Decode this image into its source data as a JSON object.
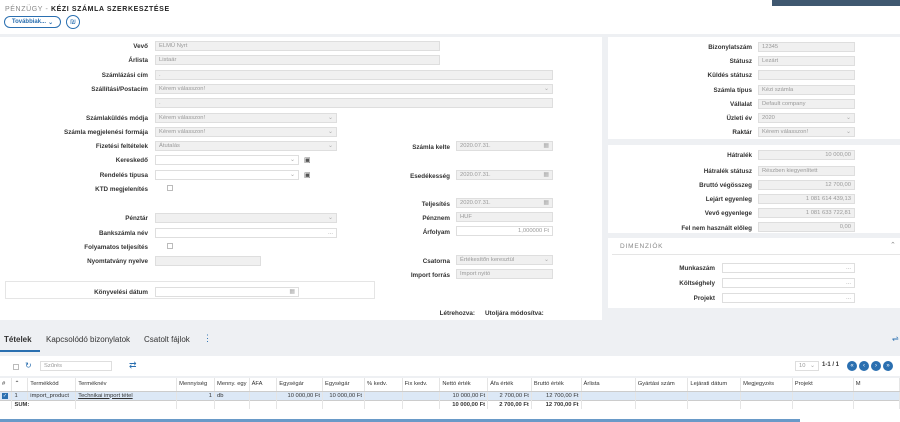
{
  "breadcrumb": {
    "section": "PÉNZÜGY",
    "sep": " - ",
    "page": "KÉZI SZÁMLA SZERKESZTÉSE"
  },
  "toolbar": {
    "more_label": "Továbbiak...",
    "chev": "⌄",
    "invoice_icon": "₪"
  },
  "left": {
    "vevo": {
      "label": "Vevő",
      "value": "ELMŰ Nyrt"
    },
    "arlista": {
      "label": "Árlista",
      "value": "Listaár"
    },
    "szamlazasi_cim": {
      "label": "Számlázási cím",
      "value": "."
    },
    "szallitasi_cim": {
      "label": "Szállítási/Postacím",
      "placeholder": "Kérem válasszon!",
      "value2": "."
    },
    "kuldes_modja": {
      "label": "Számlaküldés módja",
      "placeholder": "Kérem válasszon!"
    },
    "megjelenesi_forma": {
      "label": "Számla megjelenési formája",
      "placeholder": "Kérem válasszon!"
    },
    "fizetesi_feltetelek": {
      "label": "Fizetési feltételek",
      "value": "Átutalás"
    },
    "kereskedo": {
      "label": "Kereskedő"
    },
    "rendeles_tipusa": {
      "label": "Rendelés típusa"
    },
    "ktd": {
      "label": "KTD megjelenítés"
    },
    "penztar": {
      "label": "Pénztár"
    },
    "bankszamla": {
      "label": "Bankszámla név",
      "dots": "..."
    },
    "folyamatos": {
      "label": "Folyamatos teljesítés"
    },
    "nyomtatvany": {
      "label": "Nyomtatvány nyelve"
    },
    "konyvelesi": {
      "label": "Könyvelési dátum"
    },
    "szamla_kelte": {
      "label": "Számla kelte",
      "value": "2020.07.31."
    },
    "esedekesseg": {
      "label": "Esedékesség",
      "value": "2020.07.31."
    },
    "teljesites": {
      "label": "Teljesítés",
      "value": "2020.07.31."
    },
    "penznem": {
      "label": "Pénznem",
      "value": "HUF"
    },
    "arfolyam": {
      "label": "Árfolyam",
      "value": "1,000000 Ft"
    },
    "csatorna": {
      "label": "Csatorna",
      "value": "Értékesítőn keresztül"
    },
    "import_forras": {
      "label": "Import forrás",
      "value": "Import nyitó"
    },
    "letrehozva": {
      "label": "Létrehozva:"
    },
    "modositva": {
      "label": "Utoljára módosítva:"
    }
  },
  "right": {
    "bizonylatszam": {
      "label": "Bizonylatszám",
      "value": "12345"
    },
    "statusz": {
      "label": "Státusz",
      "value": "Lezárt"
    },
    "kuldes_statusz": {
      "label": "Küldés státusz",
      "value": ""
    },
    "szamla_tipus": {
      "label": "Számla típus",
      "value": "Kézi számla"
    },
    "vallalat": {
      "label": "Vállalat",
      "value": "Default company"
    },
    "uzleti_ev": {
      "label": "Üzleti év",
      "value": "2020"
    },
    "raktar": {
      "label": "Raktár",
      "placeholder": "Kérem válasszon!"
    },
    "hatralek": {
      "label": "Hátralék",
      "value": "10 000,00"
    },
    "hatralek_statusz": {
      "label": "Hátralék státusz",
      "value": "Részben kiegyenlített"
    },
    "brutto": {
      "label": "Bruttó végösszeg",
      "value": "12 700,00"
    },
    "lejart": {
      "label": "Lejárt egyenleg",
      "value": "1 081 614 439,13"
    },
    "vevo_egyenlege": {
      "label": "Vevő egyenlege",
      "value": "1 081 633 722,81"
    },
    "fel_nem": {
      "label": "Fel nem használt előleg",
      "value": "0,00"
    },
    "dimenziok": {
      "title": "DIMENZIÓK",
      "munkaszam": "Munkaszám",
      "koltseghely": "Költséghely",
      "projekt": "Projekt",
      "dots": "..."
    }
  },
  "tabs": [
    "Tételek",
    "Kapcsolódó bizonylatok",
    "Csatolt fájlok"
  ],
  "list": {
    "filter_placeholder": "Szűrés",
    "page_size": "10",
    "page_info": "1-1 / 1"
  },
  "table": {
    "headers": [
      "#",
      "Termékkód",
      "Terméknév",
      "Mennyiség",
      "Menny. egy",
      "ÁFA",
      "Egységár",
      "Egységár",
      "% kedv.",
      "Fix kedv.",
      "Nettó érték",
      "Áfa érték",
      "Bruttó érték",
      "Árlista",
      "Gyártási szám",
      "Lejárati dátum",
      "Megjegyzés",
      "Projekt",
      "M"
    ],
    "rows": [
      [
        "1",
        "import_product",
        "Technikai import tétel",
        "1",
        "db",
        "",
        "10 000,00 Ft",
        "10 000,00 Ft",
        "",
        "",
        "10 000,00 Ft",
        "2 700,00 Ft",
        "12 700,00 Ft",
        "",
        "",
        "",
        "",
        "",
        ""
      ]
    ],
    "sum": [
      "SUM:",
      "",
      "",
      "",
      "",
      "",
      "",
      "",
      "",
      "",
      "10 000,00 Ft",
      "2 700,00 Ft",
      "12 700,00 Ft",
      "",
      "",
      "",
      "",
      "",
      ""
    ]
  }
}
